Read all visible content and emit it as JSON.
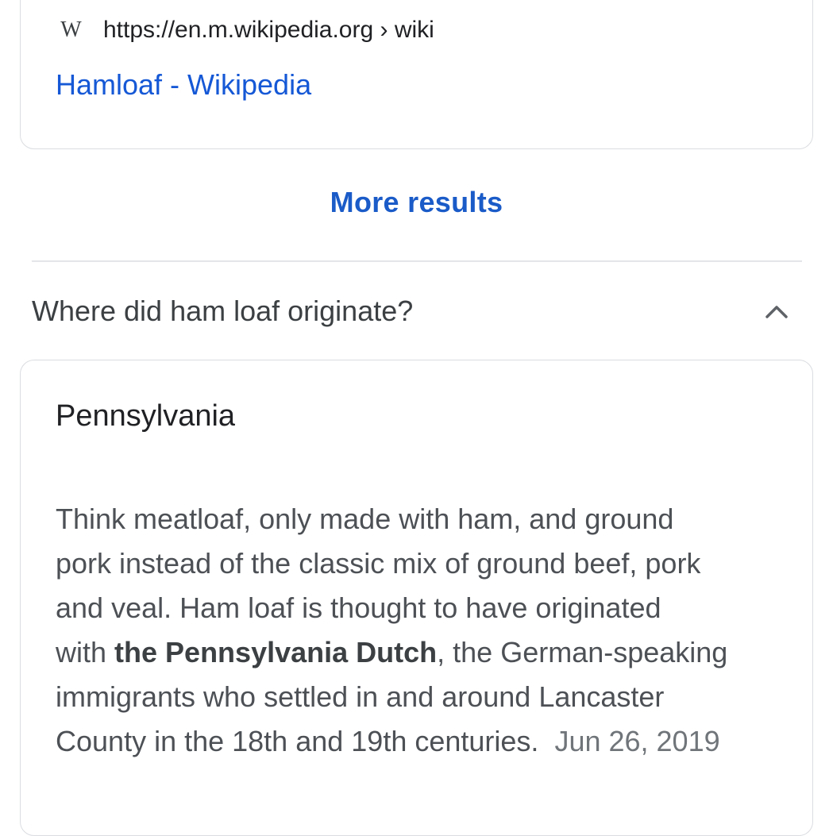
{
  "top_result": {
    "source_icon": "W",
    "source_url": "https://en.m.wikipedia.org › wiki",
    "title": "Hamloaf - Wikipedia"
  },
  "more_results_label": "More results",
  "question": {
    "text": "Where did ham loaf originate?",
    "expand_icon": "chevron-up-icon"
  },
  "answer": {
    "heading": "Pennsylvania",
    "lines": [
      "Think meatloaf, only made with ham, and ground",
      "pork instead of the classic mix of ground beef, pork",
      "and veal. Ham loaf is thought to have originated",
      "with ",
      "immigrants who settled in and around Lancaster",
      "County in the 18th and 19th centuries."
    ],
    "bold_phrase": "the Pennsylvania Dutch",
    "line4_tail": ", the German-speaking",
    "date": "Jun 26, 2019"
  },
  "colors": {
    "link": "#1558d6",
    "more_results": "#1a5bc8",
    "body_text": "#4d5156",
    "border": "#dadce0"
  }
}
